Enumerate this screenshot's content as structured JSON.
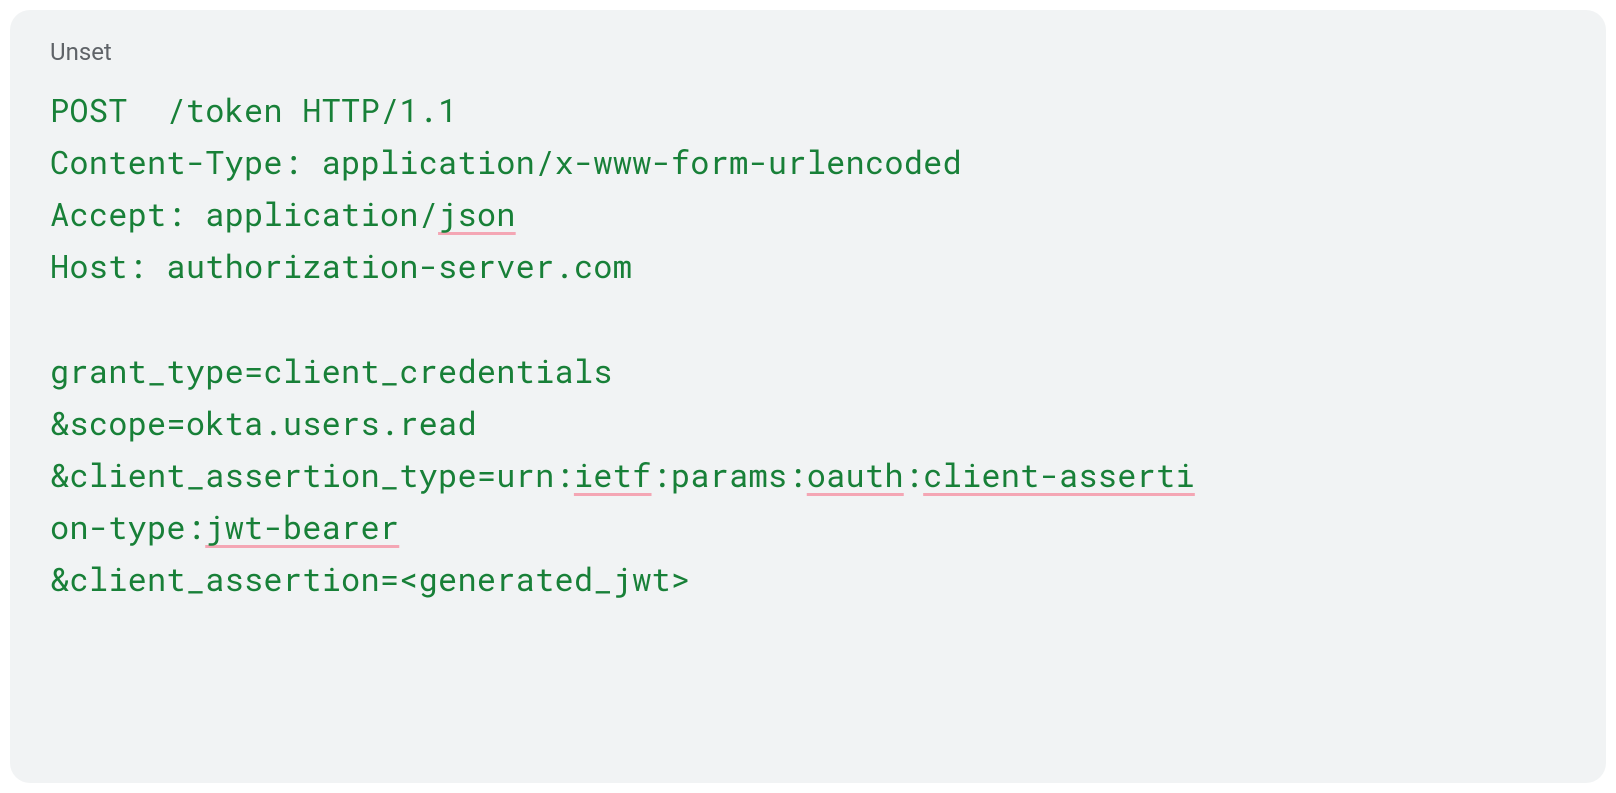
{
  "code_block": {
    "language_label": "Unset",
    "lines": {
      "l1": "POST  /token HTTP/1.1",
      "l2": "Content-Type: application/x-www-form-urlencoded",
      "l3_pre": "Accept: application/",
      "l3_u1": "json",
      "l4": "Host: authorization-server.com",
      "l6": "grant_type=client_credentials",
      "l7": "&scope=okta.users.read",
      "l8_a": "&client_assertion_type=urn:",
      "l8_u1": "ietf",
      "l8_b": ":params:",
      "l8_u2": "oauth",
      "l8_c": ":",
      "l8_u3": "client-asserti",
      "l9_a": "on-type:",
      "l9_u1": "jwt-bearer",
      "l10": "&client_assertion=<generated_jwt>"
    }
  }
}
